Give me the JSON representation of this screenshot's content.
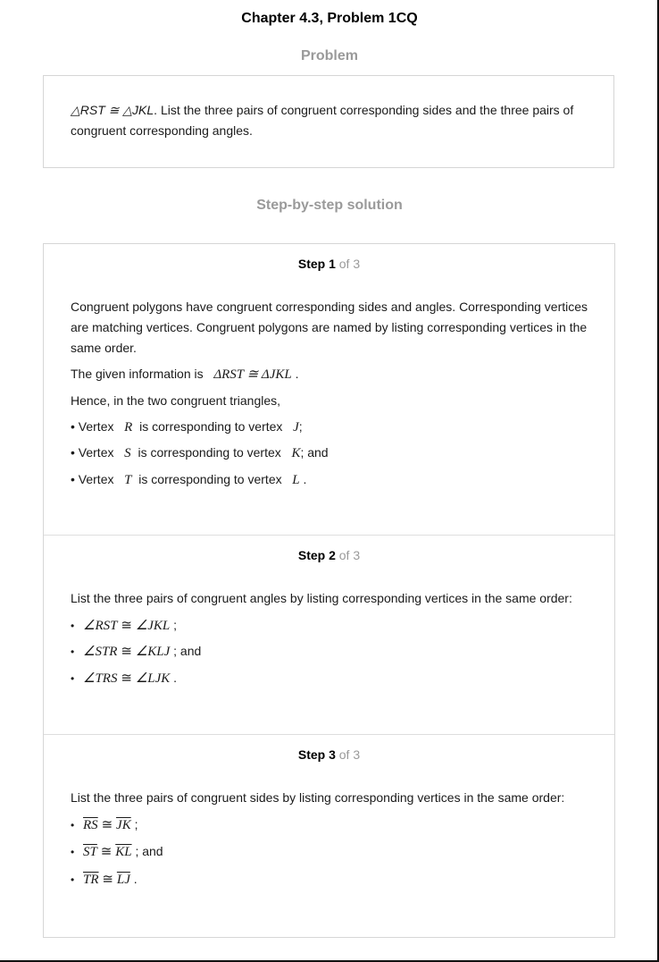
{
  "page": {
    "chapter_title": "Chapter 4.3, Problem 1CQ",
    "problem_heading": "Problem",
    "solution_heading": "Step-by-step solution"
  },
  "problem": {
    "statement_math": "△RST ≅ △JKL",
    "statement_text": ". List the three pairs of congruent corresponding sides and the three pairs of congruent corresponding angles."
  },
  "steps": [
    {
      "label": "Step 1",
      "of_label": "of 3",
      "intro": "Congruent polygons have congruent corresponding sides and angles. Corresponding vertices are matching vertices. Congruent polygons are named by listing corresponding vertices in the same order.",
      "given_prefix": "The given information is",
      "given_math": "ΔRST ≅ ΔJKL",
      "hence": "Hence, in the two congruent triangles,",
      "items": [
        {
          "bullet": "•",
          "pre": "Vertex",
          "v1": "R",
          "mid": "is corresponding to vertex",
          "v2": "J",
          "post": ";"
        },
        {
          "bullet": "•",
          "pre": "Vertex",
          "v1": "S",
          "mid": "is corresponding to vertex",
          "v2": "K",
          "post": "; and"
        },
        {
          "bullet": "•",
          "pre": "Vertex",
          "v1": "T",
          "mid": "is corresponding to vertex",
          "v2": "L",
          "post": "."
        }
      ]
    },
    {
      "label": "Step 2",
      "of_label": "of 3",
      "intro": "List the three pairs of congruent angles by listing corresponding vertices in the same order:",
      "items": [
        {
          "bullet": "•",
          "a": "∠RST",
          "rel": "≅",
          "b": "∠JKL",
          "post": ";"
        },
        {
          "bullet": "•",
          "a": "∠STR",
          "rel": "≅",
          "b": "∠KLJ",
          "post": "; and"
        },
        {
          "bullet": "•",
          "a": "∠TRS",
          "rel": "≅",
          "b": "∠LJK",
          "post": "."
        }
      ]
    },
    {
      "label": "Step 3",
      "of_label": "of 3",
      "intro": "List the three pairs of congruent sides by listing corresponding vertices in the same order:",
      "items": [
        {
          "bullet": "•",
          "a": "RS",
          "rel": "≅",
          "b": "JK",
          "post": ";"
        },
        {
          "bullet": "•",
          "a": "ST",
          "rel": "≅",
          "b": "KL",
          "post": "; and"
        },
        {
          "bullet": "•",
          "a": "TR",
          "rel": "≅",
          "b": "LJ",
          "post": "."
        }
      ]
    }
  ]
}
